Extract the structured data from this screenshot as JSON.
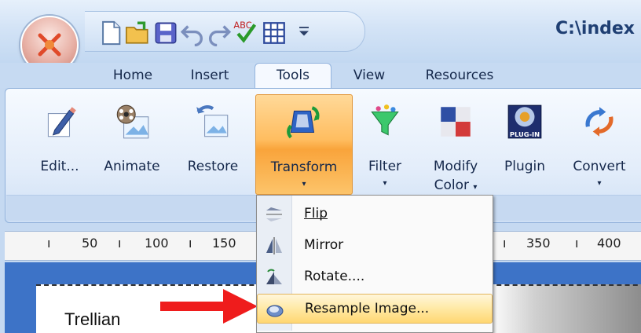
{
  "window": {
    "title": "C:\\index"
  },
  "quick_access": {
    "icons": [
      "new-document-icon",
      "open-folder-icon",
      "save-icon",
      "undo-icon",
      "redo-icon",
      "spellcheck-icon",
      "table-icon",
      "customize-icon"
    ]
  },
  "tabs": [
    {
      "label": "Home"
    },
    {
      "label": "Insert"
    },
    {
      "label": "Tools",
      "active": true
    },
    {
      "label": "View"
    },
    {
      "label": "Resources"
    }
  ],
  "ribbon": {
    "buttons": [
      {
        "label": "Edit...",
        "icon": "pencil-edit-icon"
      },
      {
        "label": "Animate",
        "icon": "film-reel-icon"
      },
      {
        "label": "Restore",
        "icon": "restore-image-icon"
      },
      {
        "label": "Transform",
        "icon": "transform-icon",
        "has_dropdown": true,
        "pressed": true
      },
      {
        "label": "Filter",
        "icon": "funnel-filter-icon",
        "has_dropdown": true
      },
      {
        "label": "Modify",
        "label2": "Color",
        "icon": "color-swatch-icon",
        "has_dropdown": true
      },
      {
        "label": "Plugin",
        "icon": "plugin-icon",
        "icon_text": "PLUG-IN"
      },
      {
        "label": "Convert",
        "icon": "convert-arrows-icon",
        "has_dropdown": true
      }
    ],
    "dropdown_glyph": "▾"
  },
  "ruler": {
    "ticks": [
      "50",
      "100",
      "150",
      "350",
      "400"
    ]
  },
  "transform_menu": {
    "items": [
      {
        "label": "Flip",
        "icon": "flip-icon"
      },
      {
        "label": "Mirror",
        "icon": "mirror-icon"
      },
      {
        "label": "Rotate....",
        "icon": "rotate-icon"
      },
      {
        "label": "Resample Image...",
        "icon": "resample-icon",
        "highlighted": true
      }
    ]
  },
  "document": {
    "visible_text": "Trellian"
  },
  "colors": {
    "accent_orange": "#f9a43b",
    "ribbon_blue": "#c6daf2",
    "canvas_blue": "#3d73c7",
    "arrow_red": "#ef1c1c",
    "menu_highlight": "#ffe9a4"
  }
}
